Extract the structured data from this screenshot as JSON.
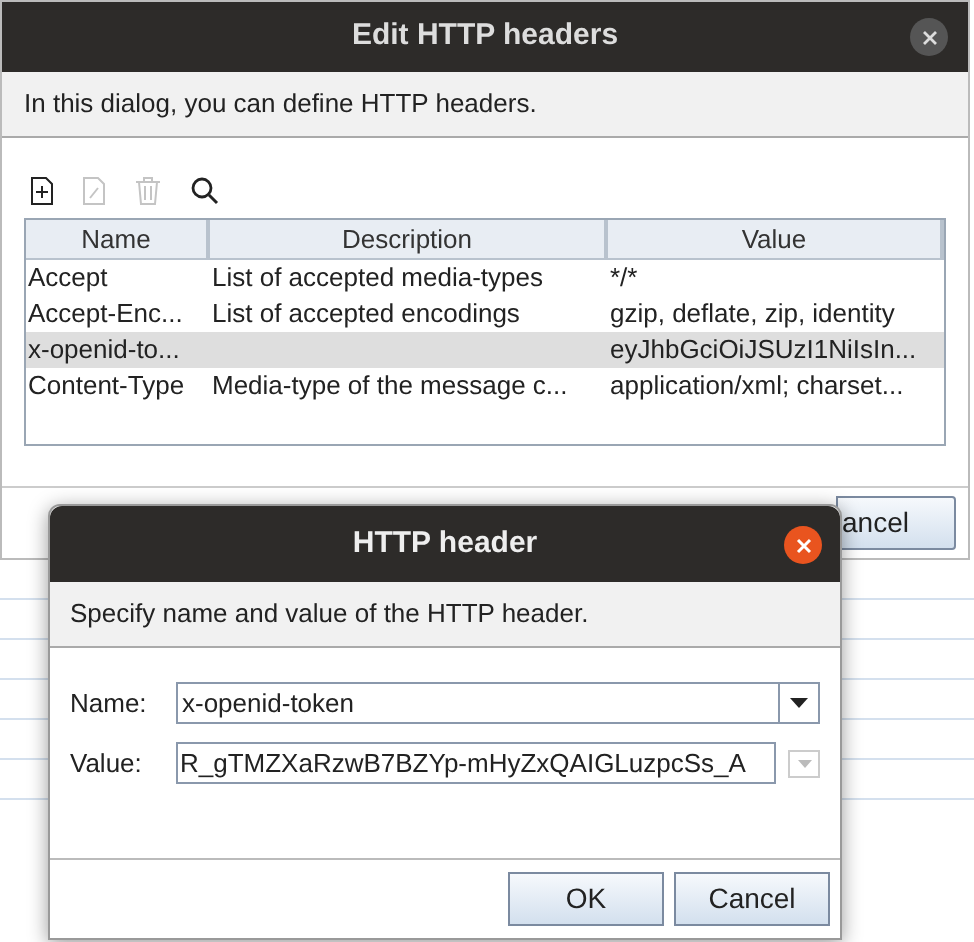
{
  "main_dialog": {
    "title": "Edit HTTP headers",
    "description": "In this dialog, you can define HTTP headers.",
    "toolbar": [
      {
        "kind": "add",
        "disabled": false
      },
      {
        "kind": "edit",
        "disabled": true
      },
      {
        "kind": "delete",
        "disabled": true
      },
      {
        "kind": "search",
        "disabled": false
      }
    ],
    "table": {
      "columns": [
        "Name",
        "Description",
        "Value"
      ],
      "rows": [
        {
          "cells": [
            "Accept",
            "List of accepted media-types",
            "*/*"
          ],
          "selected": false
        },
        {
          "cells": [
            "Accept-Enc...",
            "List of accepted encodings",
            "gzip, deflate, zip, identity"
          ],
          "selected": false
        },
        {
          "cells": [
            "x-openid-to...",
            "",
            "eyJhbGciOiJSUzI1NiIsIn..."
          ],
          "selected": true
        },
        {
          "cells": [
            "Content-Type",
            "Media-type of the message c...",
            "application/xml; charset..."
          ],
          "selected": false
        }
      ]
    },
    "buttons": [
      "ancel"
    ]
  },
  "header_dialog": {
    "title": "HTTP header",
    "description": "Specify name and value of the HTTP header.",
    "name_label": "Name:",
    "name_value": "x-openid-token",
    "value_label": "Value:",
    "value_value": "R_gTMZXaRzwB7BZYp-mHyZxQAIGLuzpcSs_A",
    "buttons": [
      "OK",
      "Cancel"
    ]
  }
}
